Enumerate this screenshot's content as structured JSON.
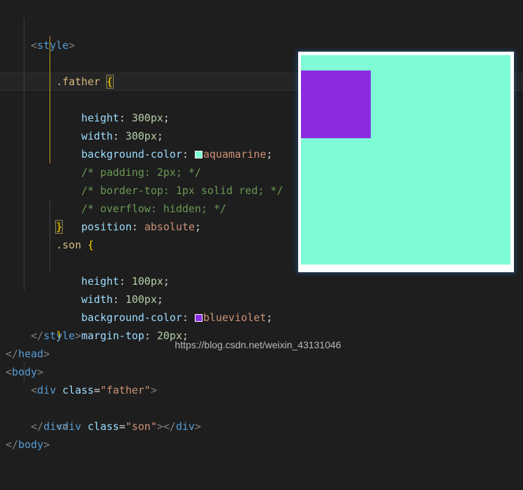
{
  "editor": {
    "theme_background": "#1e1e1e",
    "lines": [
      {
        "id": "l1",
        "indent": 1,
        "kind": "html-tag",
        "text": "<style>"
      },
      {
        "id": "l2",
        "indent": 2,
        "kind": "selector",
        "text": ".father {"
      },
      {
        "id": "l3",
        "indent": 3,
        "kind": "decl",
        "text": "height: 300px;"
      },
      {
        "id": "l4",
        "indent": 3,
        "kind": "decl",
        "text": "width: 300px;"
      },
      {
        "id": "l5",
        "indent": 3,
        "kind": "decl-color",
        "text": "background-color: aquamarine;"
      },
      {
        "id": "l6",
        "indent": 3,
        "kind": "comment",
        "text": "/* padding: 2px; */"
      },
      {
        "id": "l7",
        "indent": 3,
        "kind": "comment",
        "text": "/* border-top: 1px solid red; */"
      },
      {
        "id": "l8",
        "indent": 3,
        "kind": "comment",
        "text": "/* overflow: hidden; */"
      },
      {
        "id": "l9",
        "indent": 3,
        "kind": "decl",
        "text": "position: absolute;"
      },
      {
        "id": "l10",
        "indent": 2,
        "kind": "brace",
        "text": "}"
      },
      {
        "id": "l11",
        "indent": 2,
        "kind": "selector",
        "text": ".son {"
      },
      {
        "id": "l12",
        "indent": 3,
        "kind": "decl",
        "text": "height: 100px;"
      },
      {
        "id": "l13",
        "indent": 3,
        "kind": "decl",
        "text": "width: 100px;"
      },
      {
        "id": "l14",
        "indent": 3,
        "kind": "decl-color",
        "text": "background-color: blueviolet;"
      },
      {
        "id": "l15",
        "indent": 3,
        "kind": "decl",
        "text": "margin-top: 20px;"
      },
      {
        "id": "l16",
        "indent": 2,
        "kind": "brace",
        "text": "}"
      },
      {
        "id": "l17",
        "indent": 1,
        "kind": "html-tag",
        "text": "</style>"
      },
      {
        "id": "l18",
        "indent": 0,
        "kind": "html-tag",
        "text": "</head>"
      },
      {
        "id": "l19",
        "indent": 0,
        "kind": "html-tag",
        "text": "<body>"
      },
      {
        "id": "l20",
        "indent": 1,
        "kind": "html-tag",
        "text": "<div class=\"father\">"
      },
      {
        "id": "l21",
        "indent": 2,
        "kind": "html-tag",
        "text": "<div class=\"son\"></div>"
      },
      {
        "id": "l22",
        "indent": 1,
        "kind": "html-tag",
        "text": "</div>"
      },
      {
        "id": "l23",
        "indent": 0,
        "kind": "html-tag",
        "text": "</body>"
      }
    ],
    "tokens": {
      "style_open_lt": "<",
      "style_open_name": "style",
      "style_open_gt": ">",
      "father_selector": ".father",
      "father_open_brace": "{",
      "height_prop": "height",
      "colon": ":",
      "height_300_value": "300px",
      "semicolon": ";",
      "width_prop": "width",
      "width_300_value": "300px",
      "bgcolor_prop": "background-color",
      "aquamarine_value": "aquamarine",
      "comment_padding": "/* padding: 2px; */",
      "comment_border_top": "/* border-top: 1px solid red; */",
      "comment_overflow": "/* overflow: hidden; */",
      "position_prop": "position",
      "absolute_value": "absolute",
      "close_brace": "}",
      "son_selector": ".son",
      "son_open_brace": "{",
      "height_100_value": "100px",
      "width_100_value": "100px",
      "blueviolet_value": "blueviolet",
      "margin_top_prop": "margin-top",
      "margin_20_value": "20px",
      "style_close_lt": "</",
      "style_close_name": "style",
      "style_close_gt": ">",
      "head_close_lt": "</",
      "head_close_name": "head",
      "head_close_gt": ">",
      "body_open_lt": "<",
      "body_open_name": "body",
      "body_open_gt": ">",
      "div_lt": "<",
      "div_name": "div",
      "class_attr": "class",
      "equals": "=",
      "father_string": "\"father\"",
      "son_string": "\"son\"",
      "gt": ">",
      "div_close_lt": "</",
      "div_close_gt": ">",
      "body_close_lt": "</",
      "body_close_name": "body",
      "body_close_gt": ">"
    },
    "swatches": {
      "aquamarine_hex": "#7FFFD4",
      "blueviolet_hex": "#8A2BE2"
    }
  },
  "preview": {
    "father_color": "#7FFCD5",
    "son_color": "#8A2BE2",
    "frame_color": "#FFFFFF"
  },
  "watermark": {
    "text": "https://blog.csdn.net/weixin_43131046"
  }
}
